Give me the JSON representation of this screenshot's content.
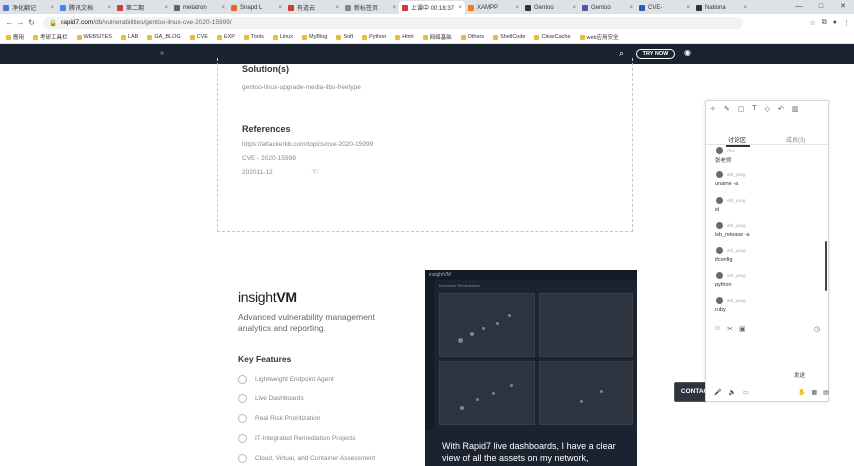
{
  "tabs": [
    {
      "label": "净化翻记",
      "color": "#4a78d0",
      "active": false
    },
    {
      "label": "腾讯文档",
      "color": "#3c8cf0",
      "active": false
    },
    {
      "label": "第二期",
      "color": "#d23b3b",
      "active": false
    },
    {
      "label": "metatron",
      "color": "#666666",
      "active": false
    },
    {
      "label": "Snapd L",
      "color": "#e06a2a",
      "active": false
    },
    {
      "label": "有道云",
      "color": "#d23b3b",
      "active": false
    },
    {
      "label": "新标签页",
      "color": "#888888",
      "active": false
    },
    {
      "label": "上课中 00:18:37",
      "color": "#d23b3b",
      "active": true
    },
    {
      "label": "XAMPP",
      "color": "#f07c20",
      "active": false
    },
    {
      "label": "Gentoo",
      "color": "#333333",
      "active": false
    },
    {
      "label": "Gentoo",
      "color": "#5a4fa5",
      "active": false
    },
    {
      "label": "CVE-",
      "color": "#2a5fb0",
      "active": false
    },
    {
      "label": "Nationa",
      "color": "#333333",
      "active": false
    }
  ],
  "address": {
    "domain": "rapid7.com",
    "path": "/db/vulnerabilities/gentoo-linux-cve-2020-15999/"
  },
  "bookmarks": [
    "應用",
    "考研工具栏",
    "WEBSITES",
    "LAB",
    "GA_BLOG",
    "CVE",
    "EXP",
    "Tools",
    "Linux",
    "MyBlog",
    "Soft",
    "Python",
    "Html",
    "网络基础",
    "Others",
    "ShellCode",
    "ClearCache",
    "web应用安全"
  ],
  "site": {
    "try_now": "TRY NOW"
  },
  "solution": {
    "heading": "Solution(s)",
    "text": "gentoo-linux-upgrade-media-libs-freetype"
  },
  "references": {
    "heading": "References",
    "items": [
      "https://attackerkb.com/topics/cve-2020-15999",
      "CVE - 2020-15999",
      "202011-12"
    ]
  },
  "insightvm": {
    "logo_a": "insight",
    "logo_b": "VM",
    "description": "Advanced vulnerability management analytics and reporting.",
    "features_heading": "Key Features",
    "features": [
      "Lightweight Endpoint Agent",
      "Live Dashboards",
      "Real Risk Prioritization",
      "IT-Integrated Remediation Projects",
      "Cloud, Virtual, and Container Assessment"
    ],
    "dashboard_title": "insightVM",
    "dashboard_subtitle": "Executive Remediation",
    "quote": "With Rapid7 live dashboards, I have a clear view of all the assets on my network,"
  },
  "chat": {
    "tabs": [
      "讨论区",
      "成员(3)"
    ],
    "messages": [
      {
        "name": "ALL",
        "text": "张老师"
      },
      {
        "name": "ath_yang",
        "text": "uname -a"
      },
      {
        "name": "ath_yang",
        "text": "id"
      },
      {
        "name": "ath_yang",
        "text": "lsb_release -a"
      },
      {
        "name": "ath_yang",
        "text": "ifconfig"
      },
      {
        "name": "ath_yang",
        "text": "python"
      },
      {
        "name": "ath_yang",
        "text": "ruby"
      }
    ],
    "send": "发送"
  },
  "contact": "CONTACT US"
}
